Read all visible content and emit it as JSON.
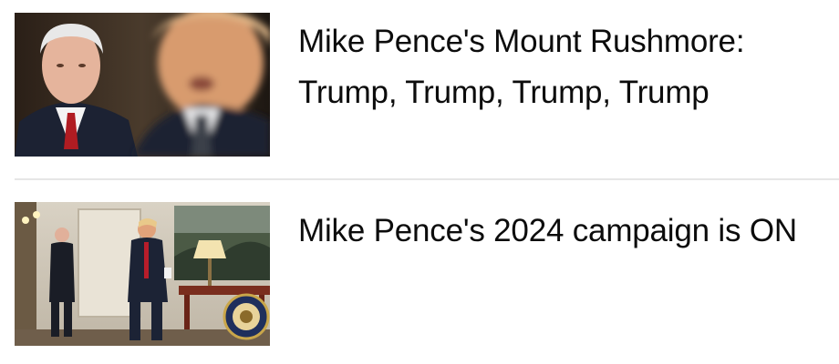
{
  "articles": [
    {
      "headline": "Mike Pence's Mount Rushmore: Trump, Trump, Trump, Trump",
      "thumbnail": "photo of Mike Pence and Donald Trump"
    },
    {
      "headline": "Mike Pence's 2024 campaign is ON",
      "thumbnail": "photo of Mike Pence and Donald Trump walking in a room with the presidential seal"
    }
  ]
}
